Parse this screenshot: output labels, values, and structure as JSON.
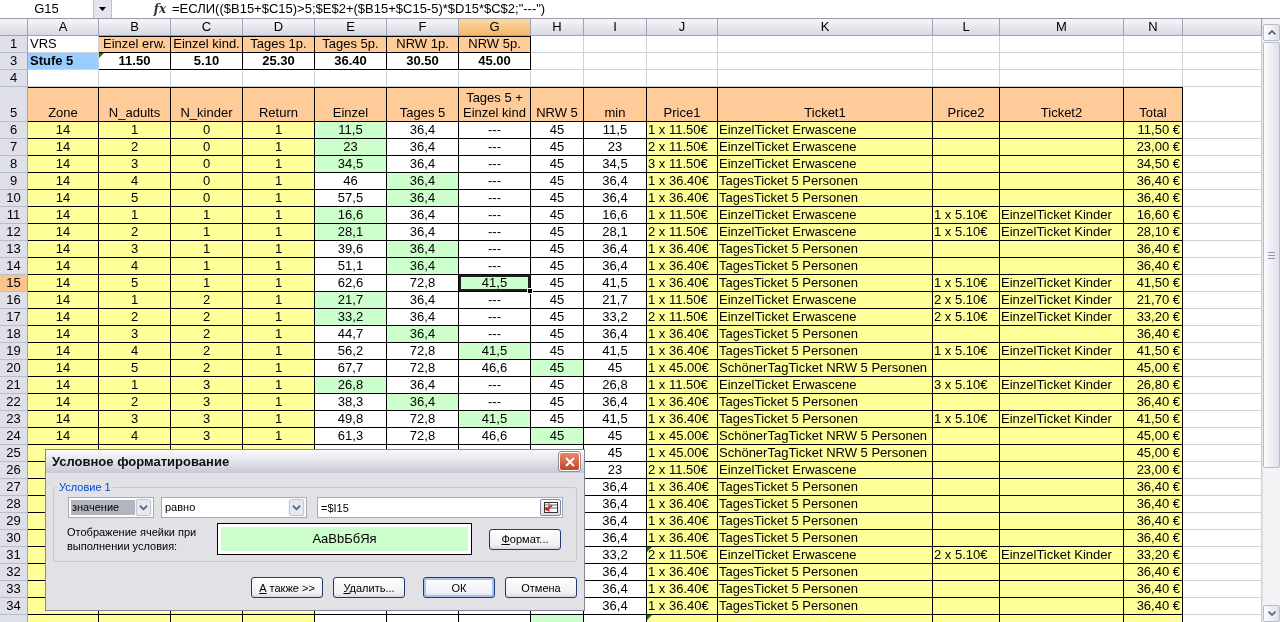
{
  "formula_bar": {
    "cell": "G15",
    "fx": "fx",
    "formula": "=ЕСЛИ(($B15+$C15)>5;$E$2+($B15+$C15-5)*$D15*$C$2;\"---\")"
  },
  "sheet": {
    "columns": [
      {
        "letter": "A",
        "header": "Zone",
        "kind": "input",
        "selected": false
      },
      {
        "letter": "B",
        "header": "N_adults",
        "kind": "input",
        "selected": false
      },
      {
        "letter": "C",
        "header": "N_kinder",
        "kind": "input",
        "selected": false
      },
      {
        "letter": "D",
        "header": "Return",
        "kind": "input",
        "selected": false
      },
      {
        "letter": "E",
        "header": "Einzel",
        "kind": "calc",
        "selected": false
      },
      {
        "letter": "F",
        "header": "Tages 5",
        "kind": "calc",
        "selected": false
      },
      {
        "letter": "G",
        "header": "Tages 5 + Einzel kind",
        "kind": "calc",
        "selected": true
      },
      {
        "letter": "H",
        "header": "NRW 5",
        "kind": "calc",
        "selected": false
      },
      {
        "letter": "I",
        "header": "min",
        "kind": "calc",
        "selected": false
      },
      {
        "letter": "J",
        "header": "Price1",
        "kind": "text",
        "selected": false
      },
      {
        "letter": "K",
        "header": "Ticket1",
        "kind": "text",
        "selected": false
      },
      {
        "letter": "L",
        "header": "Price2",
        "kind": "text",
        "selected": false
      },
      {
        "letter": "M",
        "header": "Ticket2",
        "kind": "text",
        "selected": false
      },
      {
        "letter": "N",
        "header": "Total",
        "kind": "total",
        "selected": false
      }
    ],
    "tariff": [
      {
        "n": "1",
        "selected": false,
        "kind": "names",
        "label": "VRS",
        "values": [
          "Einzel erw.",
          "Einzel kind.",
          "Tages 1p.",
          "Tages 5p.",
          "NRW 1p.",
          "NRW 5p."
        ]
      },
      {
        "n": "3",
        "selected": false,
        "kind": "prices",
        "label": "Stufe 5",
        "values": [
          {
            "text": "11.50",
            "flagged": true
          },
          "5.10",
          "25.30",
          "36.40",
          "30.50",
          "45.00"
        ]
      }
    ],
    "blank_rows": [
      {
        "n": "4",
        "selected": false
      }
    ],
    "header_row": {
      "n": "5",
      "selected": false
    },
    "rows": [
      {
        "n": "6",
        "selected": false,
        "cells": [
          "14",
          "1",
          "0",
          "1",
          {
            "text": "11,5",
            "highlighted": true
          },
          "36,4",
          "---",
          "45",
          "11,5",
          "1 x 11.50€",
          "EinzelTicket Erwascene",
          null,
          null,
          "11,50 €"
        ]
      },
      {
        "n": "7",
        "selected": false,
        "cells": [
          "14",
          "2",
          "0",
          "1",
          {
            "text": "23",
            "highlighted": true
          },
          "36,4",
          "---",
          "45",
          "23",
          "2 x 11.50€",
          "EinzelTicket Erwascene",
          null,
          null,
          "23,00 €"
        ]
      },
      {
        "n": "8",
        "selected": false,
        "cells": [
          "14",
          "3",
          "0",
          "1",
          {
            "text": "34,5",
            "highlighted": true
          },
          "36,4",
          "---",
          "45",
          "34,5",
          "3 x 11.50€",
          "EinzelTicket Erwascene",
          null,
          null,
          "34,50 €"
        ]
      },
      {
        "n": "9",
        "selected": false,
        "cells": [
          "14",
          "4",
          "0",
          "1",
          "46",
          {
            "text": "36,4",
            "highlighted": true
          },
          "---",
          "45",
          "36,4",
          "1 x 36.40€",
          "TagesTicket 5 Personen",
          null,
          null,
          "36,40 €"
        ]
      },
      {
        "n": "10",
        "selected": false,
        "cells": [
          "14",
          "5",
          "0",
          "1",
          "57,5",
          {
            "text": "36,4",
            "highlighted": true
          },
          "---",
          "45",
          "36,4",
          "1 x 36.40€",
          "TagesTicket 5 Personen",
          null,
          null,
          "36,40 €"
        ]
      },
      {
        "n": "11",
        "selected": false,
        "cells": [
          "14",
          "1",
          "1",
          "1",
          {
            "text": "16,6",
            "highlighted": true
          },
          "36,4",
          "---",
          "45",
          "16,6",
          "1 x 11.50€",
          "EinzelTicket Erwascene",
          "1 x 5.10€",
          "EinzelTicket Kinder",
          "16,60 €"
        ]
      },
      {
        "n": "12",
        "selected": false,
        "cells": [
          "14",
          "2",
          "1",
          "1",
          {
            "text": "28,1",
            "highlighted": true
          },
          "36,4",
          "---",
          "45",
          "28,1",
          "2 x 11.50€",
          "EinzelTicket Erwascene",
          "1 x 5.10€",
          "EinzelTicket Kinder",
          "28,10 €"
        ]
      },
      {
        "n": "13",
        "selected": false,
        "cells": [
          "14",
          "3",
          "1",
          "1",
          "39,6",
          {
            "text": "36,4",
            "highlighted": true
          },
          "---",
          "45",
          "36,4",
          "1 x 36.40€",
          "TagesTicket 5 Personen",
          null,
          null,
          "36,40 €"
        ]
      },
      {
        "n": "14",
        "selected": false,
        "cells": [
          "14",
          "4",
          "1",
          "1",
          "51,1",
          {
            "text": "36,4",
            "highlighted": true
          },
          "---",
          "45",
          "36,4",
          "1 x 36.40€",
          "TagesTicket 5 Personen",
          null,
          null,
          "36,40 €"
        ]
      },
      {
        "n": "15",
        "selected": true,
        "cells": [
          "14",
          "5",
          "1",
          "1",
          "62,6",
          "72,8",
          {
            "text": "41,5",
            "highlighted": true,
            "active": true
          },
          "45",
          "41,5",
          "1 x 36.40€",
          "TagesTicket 5 Personen",
          "1 x 5.10€",
          "EinzelTicket Kinder",
          "41,50 €"
        ]
      },
      {
        "n": "16",
        "selected": false,
        "cells": [
          "14",
          "1",
          "2",
          "1",
          {
            "text": "21,7",
            "highlighted": true
          },
          "36,4",
          "---",
          "45",
          "21,7",
          "1 x 11.50€",
          "EinzelTicket Erwascene",
          "2 x 5.10€",
          "EinzelTicket Kinder",
          "21,70 €"
        ]
      },
      {
        "n": "17",
        "selected": false,
        "cells": [
          "14",
          "2",
          "2",
          "1",
          {
            "text": "33,2",
            "highlighted": true
          },
          "36,4",
          "---",
          "45",
          "33,2",
          "2 x 11.50€",
          "EinzelTicket Erwascene",
          "2 x 5.10€",
          "EinzelTicket Kinder",
          "33,20 €"
        ]
      },
      {
        "n": "18",
        "selected": false,
        "cells": [
          "14",
          "3",
          "2",
          "1",
          "44,7",
          {
            "text": "36,4",
            "highlighted": true
          },
          "---",
          "45",
          "36,4",
          "1 x 36.40€",
          "TagesTicket 5 Personen",
          null,
          null,
          "36,40 €"
        ]
      },
      {
        "n": "19",
        "selected": false,
        "cells": [
          "14",
          "4",
          "2",
          "1",
          "56,2",
          "72,8",
          {
            "text": "41,5",
            "highlighted": true
          },
          "45",
          "41,5",
          "1 x 36.40€",
          "TagesTicket 5 Personen",
          "1 x 5.10€",
          "EinzelTicket Kinder",
          "41,50 €"
        ]
      },
      {
        "n": "20",
        "selected": false,
        "cells": [
          "14",
          "5",
          "2",
          "1",
          "67,7",
          "72,8",
          "46,6",
          {
            "text": "45",
            "highlighted": true
          },
          "45",
          "1 x 45.00€",
          "SchönerTagTicket NRW 5 Personen",
          null,
          null,
          "45,00 €"
        ]
      },
      {
        "n": "21",
        "selected": false,
        "cells": [
          "14",
          "1",
          "3",
          "1",
          {
            "text": "26,8",
            "highlighted": true
          },
          "36,4",
          "---",
          "45",
          "26,8",
          "1 x 11.50€",
          "EinzelTicket Erwascene",
          "3 x 5.10€",
          "EinzelTicket Kinder",
          "26,80 €"
        ]
      },
      {
        "n": "22",
        "selected": false,
        "cells": [
          "14",
          "2",
          "3",
          "1",
          "38,3",
          {
            "text": "36,4",
            "highlighted": true
          },
          "---",
          "45",
          "36,4",
          "1 x 36.40€",
          "TagesTicket 5 Personen",
          null,
          null,
          "36,40 €"
        ]
      },
      {
        "n": "23",
        "selected": false,
        "cells": [
          "14",
          "3",
          "3",
          "1",
          "49,8",
          "72,8",
          {
            "text": "41,5",
            "highlighted": true
          },
          "45",
          "41,5",
          "1 x 36.40€",
          "TagesTicket 5 Personen",
          "1 x 5.10€",
          "EinzelTicket Kinder",
          "41,50 €"
        ]
      },
      {
        "n": "24",
        "selected": false,
        "cells": [
          "14",
          "4",
          "3",
          "1",
          "61,3",
          "72,8",
          "46,6",
          {
            "text": "45",
            "highlighted": true
          },
          "45",
          "1 x 45.00€",
          "SchönerTagTicket NRW 5 Personen",
          null,
          null,
          "45,00 €"
        ]
      },
      {
        "n": "25",
        "selected": false,
        "cells": [
          null,
          null,
          null,
          null,
          null,
          null,
          null,
          null,
          "45",
          "1 x 45.00€",
          "SchönerTagTicket NRW 5 Personen",
          null,
          null,
          "45,00 €"
        ]
      },
      {
        "n": "26",
        "selected": false,
        "cells": [
          null,
          null,
          null,
          null,
          null,
          null,
          null,
          null,
          "23",
          "2 x 11.50€",
          "EinzelTicket Erwascene",
          null,
          null,
          "23,00 €"
        ]
      },
      {
        "n": "27",
        "selected": false,
        "cells": [
          null,
          null,
          null,
          null,
          null,
          null,
          null,
          null,
          "36,4",
          "1 x 36.40€",
          "TagesTicket 5 Personen",
          null,
          null,
          "36,40 €"
        ]
      },
      {
        "n": "28",
        "selected": false,
        "cells": [
          null,
          null,
          null,
          null,
          null,
          null,
          null,
          null,
          "36,4",
          "1 x 36.40€",
          "TagesTicket 5 Personen",
          null,
          null,
          "36,40 €"
        ]
      },
      {
        "n": "29",
        "selected": false,
        "cells": [
          null,
          null,
          null,
          null,
          null,
          null,
          null,
          null,
          "36,4",
          "1 x 36.40€",
          "TagesTicket 5 Personen",
          null,
          null,
          "36,40 €"
        ]
      },
      {
        "n": "30",
        "selected": false,
        "cells": [
          null,
          null,
          null,
          null,
          null,
          null,
          null,
          null,
          "36,4",
          "1 x 36.40€",
          "TagesTicket 5 Personen",
          null,
          null,
          "36,40 €"
        ]
      },
      {
        "n": "31",
        "selected": false,
        "cells": [
          null,
          null,
          null,
          null,
          null,
          null,
          null,
          null,
          "33,2",
          {
            "text": "2 x 11.50€",
            "flagged": true
          },
          "EinzelTicket Erwascene",
          "2 x 5.10€",
          "EinzelTicket Kinder",
          "33,20 €"
        ]
      },
      {
        "n": "32",
        "selected": false,
        "cells": [
          null,
          null,
          null,
          null,
          null,
          null,
          null,
          null,
          "36,4",
          "1 x 36.40€",
          "TagesTicket 5 Personen",
          null,
          null,
          "36,40 €"
        ]
      },
      {
        "n": "33",
        "selected": false,
        "cells": [
          null,
          null,
          null,
          null,
          null,
          null,
          null,
          null,
          "36,4",
          "1 x 36.40€",
          "TagesTicket 5 Personen",
          null,
          null,
          "36,40 €"
        ]
      },
      {
        "n": "34",
        "selected": false,
        "cells": [
          null,
          null,
          null,
          null,
          null,
          null,
          null,
          null,
          "36,4",
          "1 x 36.40€",
          "TagesTicket 5 Personen",
          null,
          null,
          "36,40 €"
        ]
      },
      {
        "selected": false,
        "cells": [
          null,
          null,
          null,
          null,
          null,
          null,
          null,
          {
            "highlighted": true
          },
          null,
          {
            "flagged": true
          },
          null,
          null,
          null,
          null
        ]
      }
    ]
  },
  "dialog": {
    "title": "Условное форматирование",
    "condition": {
      "legend": "Условие 1",
      "source": {
        "value": "значение",
        "focused": true
      },
      "operator": {
        "value": "равно",
        "focused": false
      },
      "value": "=$I15"
    },
    "preview": {
      "label": "Отображение ячейки при выполнении условия:",
      "sample": "AaBbБбЯя"
    },
    "format_button": {
      "label": "Формат...",
      "mnemonic": true
    },
    "buttons": [
      {
        "label": "А также >>",
        "mnemonic": true,
        "default": false
      },
      {
        "label": "Удалить...",
        "mnemonic": true,
        "default": false
      },
      {
        "label": "ОК",
        "mnemonic": false,
        "default": true
      },
      {
        "label": "Отмена",
        "mnemonic": false,
        "default": false
      }
    ]
  }
}
